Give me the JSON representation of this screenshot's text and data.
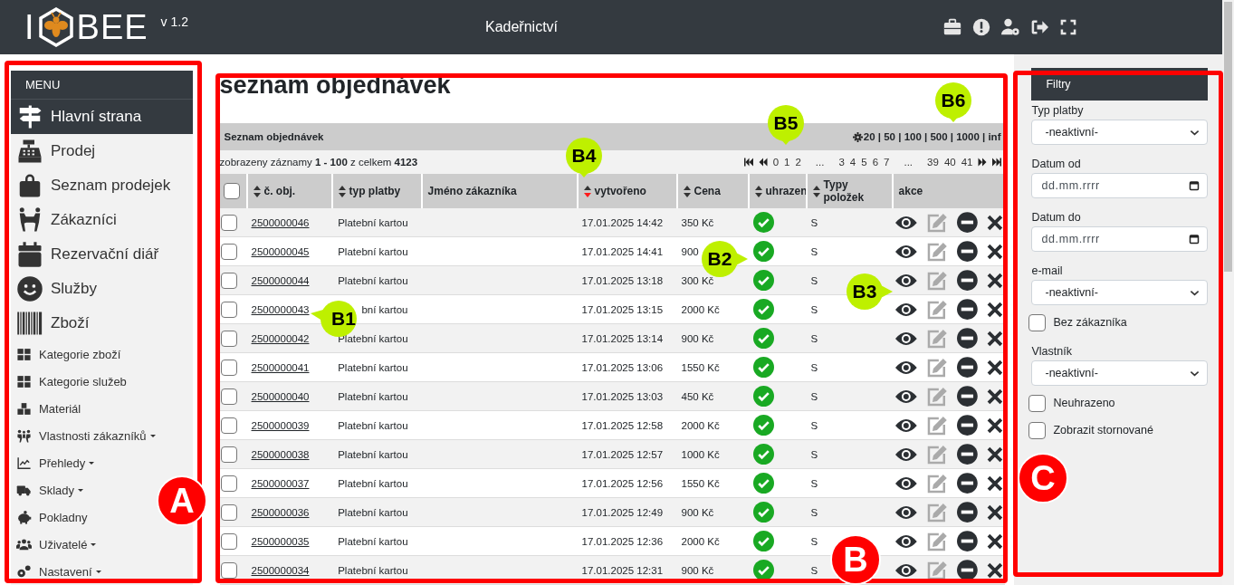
{
  "header": {
    "logo_left": "I",
    "logo_right": "BEE",
    "version": "v 1.2",
    "title": "Kadeřnictví"
  },
  "sidebar": {
    "title": "MENU",
    "items": [
      {
        "label": "Hlavní strana",
        "kind": "large",
        "dropdown": false,
        "selected": true
      },
      {
        "label": "Prodej",
        "kind": "large",
        "dropdown": false,
        "selected": false
      },
      {
        "label": "Seznam prodejek",
        "kind": "large",
        "dropdown": false,
        "selected": false
      },
      {
        "label": "Zákazníci",
        "kind": "large",
        "dropdown": false,
        "selected": false
      },
      {
        "label": "Rezervační diář",
        "kind": "large",
        "dropdown": false,
        "selected": false
      },
      {
        "label": "Služby",
        "kind": "large",
        "dropdown": false,
        "selected": false
      },
      {
        "label": "Zboží",
        "kind": "large",
        "dropdown": false,
        "selected": false
      },
      {
        "label": "Kategorie zboží",
        "kind": "small",
        "dropdown": false,
        "selected": false
      },
      {
        "label": "Kategorie služeb",
        "kind": "small",
        "dropdown": false,
        "selected": false
      },
      {
        "label": "Materiál",
        "kind": "small",
        "dropdown": false,
        "selected": false
      },
      {
        "label": "Vlastnosti zákazníků",
        "kind": "small",
        "dropdown": true,
        "selected": false
      },
      {
        "label": "Přehledy",
        "kind": "small",
        "dropdown": true,
        "selected": false
      },
      {
        "label": "Sklady",
        "kind": "small",
        "dropdown": true,
        "selected": false
      },
      {
        "label": "Pokladny",
        "kind": "small",
        "dropdown": false,
        "selected": false
      },
      {
        "label": "Uživatelé",
        "kind": "small",
        "dropdown": true,
        "selected": false
      },
      {
        "label": "Nastavení",
        "kind": "small",
        "dropdown": true,
        "selected": false
      }
    ]
  },
  "main": {
    "title": "seznam objednávek",
    "panel_title": "Seznam objednávek",
    "page_sizes": "20 | 50 | 100 | 500 | 1000 | inf",
    "records_info": "zobrazeny záznamy **1 - 100** z celkem **4123**",
    "select_all": {
      "checked": false
    },
    "pages": [
      "0",
      "1",
      "2",
      "...",
      "3",
      "4",
      "5",
      "6",
      "7",
      "...",
      "39",
      "40",
      "41"
    ],
    "table": {
      "columns": [
        {
          "label": "č. obj.",
          "sortable": true,
          "sorted": false
        },
        {
          "label": "typ platby",
          "sortable": true,
          "sorted": false
        },
        {
          "label": "Jméno zákazníka",
          "sortable": false,
          "sorted": false
        },
        {
          "label": "vytvořeno",
          "sortable": true,
          "sorted": true
        },
        {
          "label": "Cena",
          "sortable": true,
          "sorted": false
        },
        {
          "label": "uhrazen",
          "sortable": true,
          "sorted": false
        },
        {
          "label": "Typy položek",
          "sortable": true,
          "sorted": false
        },
        {
          "label": "akce",
          "sortable": false,
          "sorted": false
        }
      ],
      "rows": [
        {
          "id": "2500000046",
          "payment": "Platební kartou",
          "created": "17.01.2025 14:42",
          "price": "350 Kč",
          "paid": true,
          "item_types": "S",
          "checked": false
        },
        {
          "id": "2500000045",
          "payment": "Platební kartou",
          "created": "17.01.2025 14:41",
          "price": "900",
          "paid": true,
          "item_types": "S",
          "checked": false
        },
        {
          "id": "2500000044",
          "payment": "Platební kartou",
          "created": "17.01.2025 13:18",
          "price": "300 Kč",
          "paid": true,
          "item_types": "S",
          "checked": false
        },
        {
          "id": "2500000043",
          "payment": "bní kartou",
          "created": "17.01.2025 13:15",
          "price": "2000 Kč",
          "paid": true,
          "item_types": "S",
          "checked": false
        },
        {
          "id": "2500000042",
          "payment": "Platební kartou",
          "created": "17.01.2025 13:14",
          "price": "900 Kč",
          "paid": true,
          "item_types": "S",
          "checked": false
        },
        {
          "id": "2500000041",
          "payment": "Platební kartou",
          "created": "17.01.2025 13:06",
          "price": "1550 Kč",
          "paid": true,
          "item_types": "S",
          "checked": false
        },
        {
          "id": "2500000040",
          "payment": "Platební kartou",
          "created": "17.01.2025 13:03",
          "price": "450 Kč",
          "paid": true,
          "item_types": "S",
          "checked": false
        },
        {
          "id": "2500000039",
          "payment": "Platební kartou",
          "created": "17.01.2025 12:58",
          "price": "2000 Kč",
          "paid": true,
          "item_types": "S",
          "checked": false
        },
        {
          "id": "2500000038",
          "payment": "Platební kartou",
          "created": "17.01.2025 12:57",
          "price": "1000 Kč",
          "paid": true,
          "item_types": "S",
          "checked": false
        },
        {
          "id": "2500000037",
          "payment": "Platební kartou",
          "created": "17.01.2025 12:56",
          "price": "1550 Kč",
          "paid": true,
          "item_types": "S",
          "checked": false
        },
        {
          "id": "2500000036",
          "payment": "Platební kartou",
          "created": "17.01.2025 12:49",
          "price": "900 Kč",
          "paid": true,
          "item_types": "S",
          "checked": false
        },
        {
          "id": "2500000035",
          "payment": "Platební kartou",
          "created": "17.01.2025 12:36",
          "price": "2000 Kč",
          "paid": true,
          "item_types": "S",
          "checked": false
        },
        {
          "id": "2500000034",
          "payment": "Platební kartou",
          "created": "17.01.2025 12:31",
          "price": "900 Kč",
          "paid": true,
          "item_types": "S",
          "checked": false
        }
      ]
    }
  },
  "filters": {
    "title": "Filtry",
    "fields": [
      {
        "kind": "select",
        "label": "Typ platby",
        "value": "-neaktivní-"
      },
      {
        "kind": "date",
        "label": "Datum od",
        "placeholder": "dd.mm.rrrr"
      },
      {
        "kind": "date",
        "label": "Datum do",
        "placeholder": "dd.mm.rrrr"
      },
      {
        "kind": "select",
        "label": "e-mail",
        "value": "-neaktivní-"
      },
      {
        "kind": "checkbox",
        "label": "Bez zákazníka",
        "checked": false
      },
      {
        "kind": "select",
        "label": "Vlastník",
        "value": "-neaktivní-"
      },
      {
        "kind": "checkbox",
        "label": "Neuhrazeno",
        "checked": false
      },
      {
        "kind": "checkbox",
        "label": "Zobrazit stornované",
        "checked": false
      }
    ]
  },
  "annotations": {
    "markers": [
      "A",
      "B",
      "C"
    ],
    "callouts": [
      {
        "label": "B1",
        "kind": "left"
      },
      {
        "label": "B2",
        "kind": "right"
      },
      {
        "label": "B3",
        "kind": "right"
      },
      {
        "label": "B4",
        "kind": "down"
      },
      {
        "label": "B5",
        "kind": "down"
      },
      {
        "label": "B6",
        "kind": "down"
      }
    ]
  }
}
